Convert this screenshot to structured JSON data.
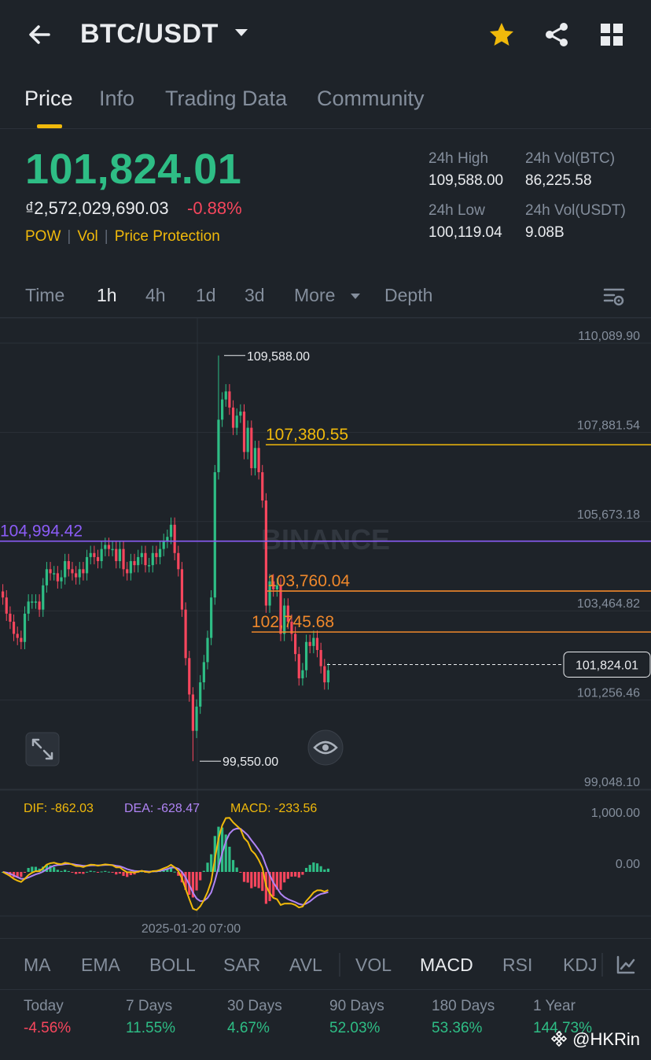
{
  "header": {
    "pair": "BTC/USDT",
    "icons": [
      "back-arrow-icon",
      "caret-down-icon",
      "star-icon",
      "share-icon",
      "grid-icon"
    ]
  },
  "tabs": [
    {
      "label": "Price",
      "active": true
    },
    {
      "label": "Info",
      "active": false
    },
    {
      "label": "Trading Data",
      "active": false
    },
    {
      "label": "Community",
      "active": false
    }
  ],
  "price": {
    "last": "101,824.01",
    "fiat": "₫2,572,029,690.03",
    "change": "-0.88%",
    "tags": [
      "POW",
      "Vol",
      "Price Protection"
    ]
  },
  "stats": {
    "high_label": "24h High",
    "high_value": "109,588.00",
    "volbtc_label": "24h Vol(BTC)",
    "volbtc_value": "86,225.58",
    "low_label": "24h Low",
    "low_value": "100,119.04",
    "volusdt_label": "24h Vol(USDT)",
    "volusdt_value": "9.08B"
  },
  "timebar": {
    "items": [
      "Time",
      "1h",
      "4h",
      "1d",
      "3d",
      "More",
      "Depth"
    ],
    "active": "1h"
  },
  "chart_data": {
    "type": "candlestick",
    "watermark": "BINANCE",
    "y_axis_labels": [
      "110,089.90",
      "107,881.54",
      "105,673.18",
      "103,464.82",
      "101,256.46",
      "99,048.10"
    ],
    "ylim": [
      99048.1,
      110089.9
    ],
    "high_marker": "109,588.00",
    "low_marker": "99,550.00",
    "last_price_tag": "101,824.01",
    "lines": [
      {
        "label": "107,380.55",
        "value": 107380.55,
        "color": "#f0b90b"
      },
      {
        "label": "104,994.42",
        "value": 104994.42,
        "color": "#8b5cf6"
      },
      {
        "label": "103,760.04",
        "value": 103760.04,
        "color": "#f0882b"
      },
      {
        "label": "102,745.68",
        "value": 102745.68,
        "color": "#f0882b"
      }
    ],
    "x_label": "2025-01-20 07:00",
    "closes": [
      103600,
      103200,
      103000,
      102700,
      102600,
      102500,
      103200,
      103500,
      103500,
      103500,
      103300,
      103900,
      104300,
      104200,
      104200,
      104000,
      104100,
      104500,
      104300,
      104200,
      104100,
      104300,
      104200,
      104600,
      104700,
      104600,
      104500,
      104800,
      104900,
      104800,
      104800,
      104500,
      104800,
      104300,
      104200,
      104500,
      104400,
      104600,
      104700,
      104400,
      104400,
      104700,
      104600,
      104800,
      105000,
      105100,
      105400,
      104700,
      104300,
      103300,
      102100,
      101200,
      100300,
      100900,
      101500,
      102000,
      102600,
      103600,
      106700,
      108000,
      108500,
      108700,
      108300,
      107800,
      108100,
      108200,
      107200,
      107800,
      106800,
      107300,
      106700,
      106000,
      103400,
      104000,
      103800,
      103900,
      102700,
      103400,
      103000,
      102700,
      102200,
      101600,
      101800,
      102500,
      102400,
      102600,
      102300,
      101900,
      101500,
      101800
    ],
    "macd": {
      "dif_label": "DIF: -862.03",
      "dea_label": "DEA: -628.47",
      "macd_label": "MACD: -233.56",
      "axis_labels": [
        "1,000.00",
        "0.00"
      ]
    }
  },
  "indicators": {
    "items": [
      "MA",
      "EMA",
      "BOLL",
      "SAR",
      "AVL",
      "VOL",
      "MACD",
      "RSI",
      "KDJ"
    ],
    "active": "MACD"
  },
  "performance": [
    {
      "label": "Today",
      "value": "-4.56%"
    },
    {
      "label": "7 Days",
      "value": "11.55%"
    },
    {
      "label": "30 Days",
      "value": "4.67%"
    },
    {
      "label": "90 Days",
      "value": "52.03%"
    },
    {
      "label": "180 Days",
      "value": "53.36%"
    },
    {
      "label": "1 Year",
      "value": "144.73%"
    }
  ],
  "watermark_handle": "@HKRin"
}
